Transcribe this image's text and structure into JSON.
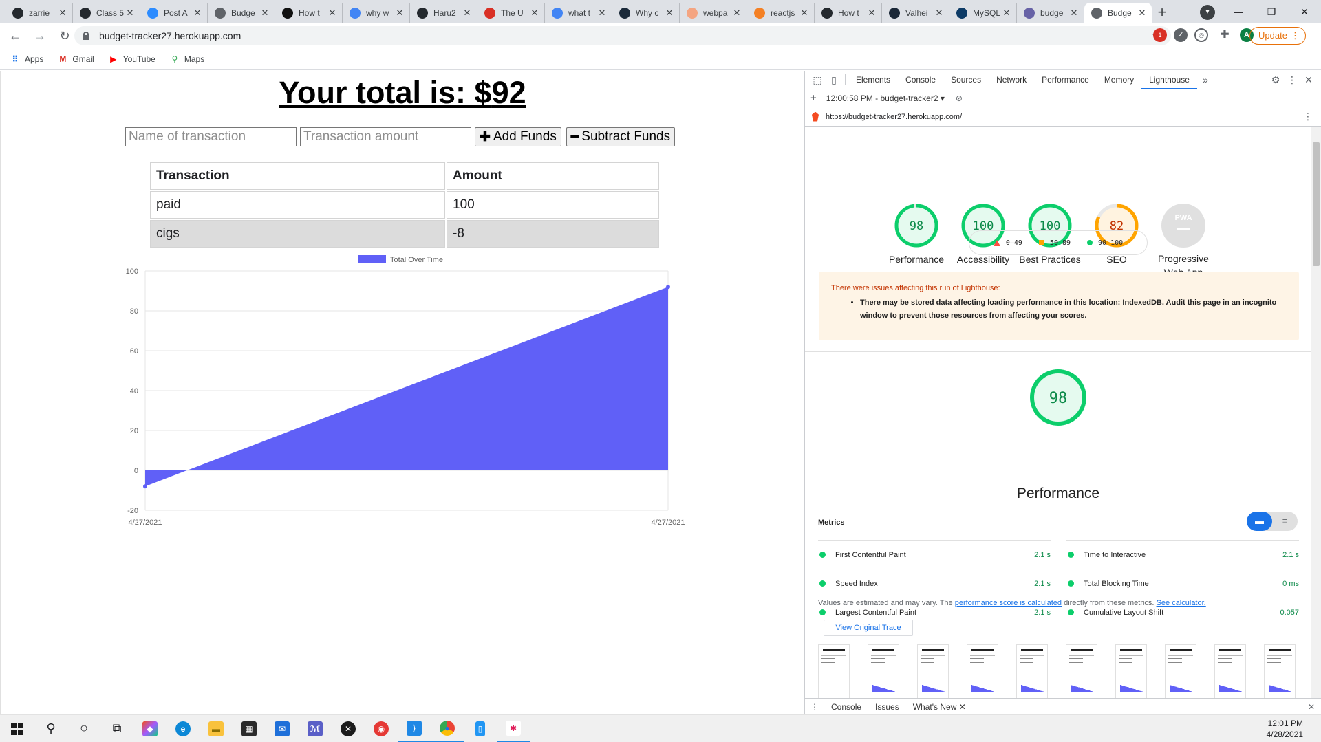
{
  "browser": {
    "tabs": [
      {
        "label": "zarrie",
        "icon": "github-icon",
        "color": "#24292e"
      },
      {
        "label": "Class 5",
        "icon": "github-icon",
        "color": "#24292e"
      },
      {
        "label": "Post A",
        "icon": "zoom-icon",
        "color": "#2d8cff"
      },
      {
        "label": "Budge",
        "icon": "document-icon",
        "color": "#5f6368"
      },
      {
        "label": "How t",
        "icon": "r-icon",
        "color": "#111111"
      },
      {
        "label": "why w",
        "icon": "google-icon",
        "color": "#4285f4"
      },
      {
        "label": "Haru2",
        "icon": "github-icon",
        "color": "#24292e"
      },
      {
        "label": "The U",
        "icon": "gmail-icon",
        "color": "#d93025"
      },
      {
        "label": "what t",
        "icon": "google-icon",
        "color": "#4285f4"
      },
      {
        "label": "Why c",
        "icon": "react-icon",
        "color": "#1b2a3a"
      },
      {
        "label": "webpa",
        "icon": "cloud-icon",
        "color": "#f4a582"
      },
      {
        "label": "reactjs",
        "icon": "stackoverflow-icon",
        "color": "#f48024"
      },
      {
        "label": "How t",
        "icon": "github-icon",
        "color": "#24292e"
      },
      {
        "label": "Valhei",
        "icon": "steam-icon",
        "color": "#1b2838"
      },
      {
        "label": "MySQL",
        "icon": "mysql-icon",
        "color": "#0d3b66"
      },
      {
        "label": "budge",
        "icon": "heroku-icon",
        "color": "#6762a6"
      },
      {
        "label": "Budge",
        "icon": "document-icon",
        "color": "#5f6368"
      }
    ],
    "active_tab_index": 16,
    "url": "budget-tracker27.herokuapp.com",
    "update_label": "Update",
    "avatar_letter": "A",
    "ext_badge": "1",
    "bookmarks": [
      {
        "label": "Apps",
        "icon": "apps-grid-icon",
        "color": "#1a73e8"
      },
      {
        "label": "Gmail",
        "icon": "gmail-icon",
        "color": "#d93025"
      },
      {
        "label": "YouTube",
        "icon": "youtube-icon",
        "color": "#ff0000"
      },
      {
        "label": "Maps",
        "icon": "maps-pin-icon",
        "color": "#34a853"
      }
    ]
  },
  "app": {
    "total_prefix": "Your total is: $",
    "total_value": "92",
    "name_placeholder": "Name of transaction",
    "amount_placeholder": "Transaction amount",
    "add_label": "Add Funds",
    "subtract_label": "Subtract Funds",
    "table_headers": [
      "Transaction",
      "Amount"
    ],
    "transactions": [
      {
        "name": "paid",
        "amount": "100"
      },
      {
        "name": "cigs",
        "amount": "-8"
      }
    ],
    "accent_color": "#6060f7"
  },
  "chart_data": {
    "type": "area",
    "legend": "Total Over Time",
    "x": [
      "4/27/2021",
      "4/27/2021"
    ],
    "series": [
      {
        "name": "Total Over Time",
        "values": [
          -8,
          92
        ]
      }
    ],
    "y_ticks": [
      100,
      80,
      60,
      40,
      20,
      0,
      -20
    ],
    "ylim": [
      -20,
      100
    ],
    "grid": true,
    "legend_position": "top"
  },
  "devtools": {
    "tabs": [
      "Elements",
      "Console",
      "Sources",
      "Network",
      "Performance",
      "Memory",
      "Lighthouse"
    ],
    "active_tab": "Lighthouse",
    "report_selector": "12:00:58 PM - budget-tracker2",
    "report_url": "https://budget-tracker27.herokuapp.com/",
    "scores": [
      {
        "label": "Performance",
        "value": "98",
        "color": "#0cce6b"
      },
      {
        "label": "Accessibility",
        "value": "100",
        "color": "#0cce6b"
      },
      {
        "label": "Best Practices",
        "value": "100",
        "color": "#0cce6b"
      },
      {
        "label": "SEO",
        "value": "82",
        "color": "#ffa400"
      }
    ],
    "pwa_label": "Progressive Web App",
    "pwa_badge": "PWA",
    "legend": [
      {
        "range": "0–49",
        "color": "#ff4e42"
      },
      {
        "range": "50–89",
        "color": "#ffa400"
      },
      {
        "range": "90–100",
        "color": "#0cce6b"
      }
    ],
    "warning_title": "There were issues affecting this run of Lighthouse:",
    "warning_text": "There may be stored data affecting loading performance in this location: IndexedDB. Audit this page in an incognito window to prevent those resources from affecting your scores.",
    "perf_score": "98",
    "perf_title": "Performance",
    "metrics_label": "Metrics",
    "metrics": [
      {
        "label": "First Contentful Paint",
        "value": "2.1 s"
      },
      {
        "label": "Time to Interactive",
        "value": "2.1 s"
      },
      {
        "label": "Speed Index",
        "value": "2.1 s"
      },
      {
        "label": "Total Blocking Time",
        "value": "0 ms"
      },
      {
        "label": "Largest Contentful Paint",
        "value": "2.1 s"
      },
      {
        "label": "Cumulative Layout Shift",
        "value": "0.057"
      }
    ],
    "values_note_prefix": "Values are estimated and may vary. The ",
    "values_note_link": "performance score is calculated",
    "values_note_mid": " directly from these metrics. ",
    "values_note_link2": "See calculator.",
    "view_trace_label": "View Original Trace",
    "thumb_title": "Your total is: $92",
    "drawer_tabs": [
      "Console",
      "Issues",
      "What's New"
    ]
  },
  "taskbar": {
    "time": "12:01 PM",
    "date": "4/28/2021"
  }
}
